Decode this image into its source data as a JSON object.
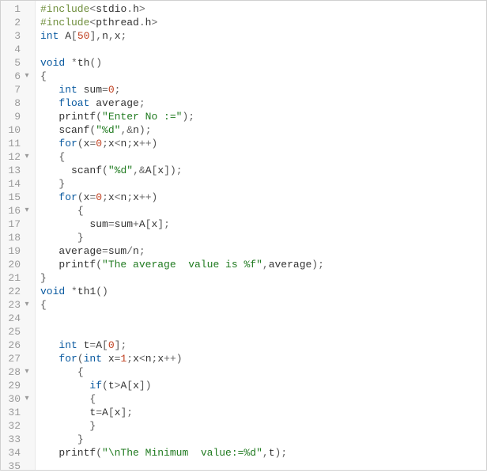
{
  "lines": [
    {
      "n": 1,
      "fold": "",
      "tokens": [
        [
          "pp",
          "#include"
        ],
        [
          "op",
          "<"
        ],
        [
          "id",
          "stdio"
        ],
        [
          "op",
          "."
        ],
        [
          "id",
          "h"
        ],
        [
          "op",
          ">"
        ]
      ]
    },
    {
      "n": 2,
      "fold": "",
      "tokens": [
        [
          "pp",
          "#include"
        ],
        [
          "op",
          "<"
        ],
        [
          "id",
          "pthread"
        ],
        [
          "op",
          "."
        ],
        [
          "id",
          "h"
        ],
        [
          "op",
          ">"
        ]
      ]
    },
    {
      "n": 3,
      "fold": "",
      "tokens": [
        [
          "ty",
          "int"
        ],
        [
          "id",
          " A"
        ],
        [
          "pn",
          "["
        ],
        [
          "num",
          "50"
        ],
        [
          "pn",
          "]"
        ],
        [
          "op",
          ","
        ],
        [
          "id",
          "n"
        ],
        [
          "op",
          ","
        ],
        [
          "id",
          "x"
        ],
        [
          "op",
          ";"
        ]
      ]
    },
    {
      "n": 4,
      "fold": "",
      "tokens": []
    },
    {
      "n": 5,
      "fold": "",
      "tokens": [
        [
          "ty",
          "void"
        ],
        [
          "id",
          " "
        ],
        [
          "op",
          "*"
        ],
        [
          "id",
          "th"
        ],
        [
          "pn",
          "()"
        ]
      ]
    },
    {
      "n": 6,
      "fold": "▾",
      "tokens": [
        [
          "pn",
          "{"
        ]
      ]
    },
    {
      "n": 7,
      "fold": "",
      "tokens": [
        [
          "id",
          "   "
        ],
        [
          "ty",
          "int"
        ],
        [
          "id",
          " sum"
        ],
        [
          "op",
          "="
        ],
        [
          "num",
          "0"
        ],
        [
          "op",
          ";"
        ]
      ]
    },
    {
      "n": 8,
      "fold": "",
      "tokens": [
        [
          "id",
          "   "
        ],
        [
          "ty",
          "float"
        ],
        [
          "id",
          " average"
        ],
        [
          "op",
          ";"
        ]
      ]
    },
    {
      "n": 9,
      "fold": "",
      "tokens": [
        [
          "id",
          "   "
        ],
        [
          "id",
          "printf"
        ],
        [
          "pn",
          "("
        ],
        [
          "str",
          "\"Enter No :=\""
        ],
        [
          "pn",
          ")"
        ],
        [
          "op",
          ";"
        ]
      ]
    },
    {
      "n": 10,
      "fold": "",
      "tokens": [
        [
          "id",
          "   "
        ],
        [
          "id",
          "scanf"
        ],
        [
          "pn",
          "("
        ],
        [
          "str",
          "\"%d\""
        ],
        [
          "op",
          ","
        ],
        [
          "op",
          "&"
        ],
        [
          "id",
          "n"
        ],
        [
          "pn",
          ")"
        ],
        [
          "op",
          ";"
        ]
      ]
    },
    {
      "n": 11,
      "fold": "",
      "tokens": [
        [
          "id",
          "   "
        ],
        [
          "kw",
          "for"
        ],
        [
          "pn",
          "("
        ],
        [
          "id",
          "x"
        ],
        [
          "op",
          "="
        ],
        [
          "num",
          "0"
        ],
        [
          "op",
          ";"
        ],
        [
          "id",
          "x"
        ],
        [
          "op",
          "<"
        ],
        [
          "id",
          "n"
        ],
        [
          "op",
          ";"
        ],
        [
          "id",
          "x"
        ],
        [
          "op",
          "++"
        ],
        [
          "pn",
          ")"
        ]
      ]
    },
    {
      "n": 12,
      "fold": "▾",
      "tokens": [
        [
          "id",
          "   "
        ],
        [
          "pn",
          "{"
        ]
      ]
    },
    {
      "n": 13,
      "fold": "",
      "tokens": [
        [
          "id",
          "     "
        ],
        [
          "id",
          "scanf"
        ],
        [
          "pn",
          "("
        ],
        [
          "str",
          "\"%d\""
        ],
        [
          "op",
          ","
        ],
        [
          "op",
          "&"
        ],
        [
          "id",
          "A"
        ],
        [
          "pn",
          "["
        ],
        [
          "id",
          "x"
        ],
        [
          "pn",
          "]"
        ],
        [
          "pn",
          ")"
        ],
        [
          "op",
          ";"
        ]
      ]
    },
    {
      "n": 14,
      "fold": "",
      "tokens": [
        [
          "id",
          "   "
        ],
        [
          "pn",
          "}"
        ]
      ]
    },
    {
      "n": 15,
      "fold": "",
      "tokens": [
        [
          "id",
          "   "
        ],
        [
          "kw",
          "for"
        ],
        [
          "pn",
          "("
        ],
        [
          "id",
          "x"
        ],
        [
          "op",
          "="
        ],
        [
          "num",
          "0"
        ],
        [
          "op",
          ";"
        ],
        [
          "id",
          "x"
        ],
        [
          "op",
          "<"
        ],
        [
          "id",
          "n"
        ],
        [
          "op",
          ";"
        ],
        [
          "id",
          "x"
        ],
        [
          "op",
          "++"
        ],
        [
          "pn",
          ")"
        ]
      ]
    },
    {
      "n": 16,
      "fold": "▾",
      "tokens": [
        [
          "id",
          "      "
        ],
        [
          "pn",
          "{"
        ]
      ]
    },
    {
      "n": 17,
      "fold": "",
      "tokens": [
        [
          "id",
          "        "
        ],
        [
          "id",
          "sum"
        ],
        [
          "op",
          "="
        ],
        [
          "id",
          "sum"
        ],
        [
          "op",
          "+"
        ],
        [
          "id",
          "A"
        ],
        [
          "pn",
          "["
        ],
        [
          "id",
          "x"
        ],
        [
          "pn",
          "]"
        ],
        [
          "op",
          ";"
        ]
      ]
    },
    {
      "n": 18,
      "fold": "",
      "tokens": [
        [
          "id",
          "      "
        ],
        [
          "pn",
          "}"
        ]
      ]
    },
    {
      "n": 19,
      "fold": "",
      "tokens": [
        [
          "id",
          "   "
        ],
        [
          "id",
          "average"
        ],
        [
          "op",
          "="
        ],
        [
          "id",
          "sum"
        ],
        [
          "op",
          "/"
        ],
        [
          "id",
          "n"
        ],
        [
          "op",
          ";"
        ]
      ]
    },
    {
      "n": 20,
      "fold": "",
      "tokens": [
        [
          "id",
          "   "
        ],
        [
          "id",
          "printf"
        ],
        [
          "pn",
          "("
        ],
        [
          "str",
          "\"The average  value is %f\""
        ],
        [
          "op",
          ","
        ],
        [
          "id",
          "average"
        ],
        [
          "pn",
          ")"
        ],
        [
          "op",
          ";"
        ]
      ]
    },
    {
      "n": 21,
      "fold": "",
      "tokens": [
        [
          "pn",
          "}"
        ]
      ]
    },
    {
      "n": 22,
      "fold": "",
      "tokens": [
        [
          "ty",
          "void"
        ],
        [
          "id",
          " "
        ],
        [
          "op",
          "*"
        ],
        [
          "id",
          "th1"
        ],
        [
          "pn",
          "()"
        ]
      ]
    },
    {
      "n": 23,
      "fold": "▾",
      "tokens": [
        [
          "pn",
          "{"
        ]
      ]
    },
    {
      "n": 24,
      "fold": "",
      "tokens": []
    },
    {
      "n": 25,
      "fold": "",
      "tokens": []
    },
    {
      "n": 26,
      "fold": "",
      "tokens": [
        [
          "id",
          "   "
        ],
        [
          "ty",
          "int"
        ],
        [
          "id",
          " t"
        ],
        [
          "op",
          "="
        ],
        [
          "id",
          "A"
        ],
        [
          "pn",
          "["
        ],
        [
          "num",
          "0"
        ],
        [
          "pn",
          "]"
        ],
        [
          "op",
          ";"
        ]
      ]
    },
    {
      "n": 27,
      "fold": "",
      "tokens": [
        [
          "id",
          "   "
        ],
        [
          "kw",
          "for"
        ],
        [
          "pn",
          "("
        ],
        [
          "ty",
          "int"
        ],
        [
          "id",
          " x"
        ],
        [
          "op",
          "="
        ],
        [
          "num",
          "1"
        ],
        [
          "op",
          ";"
        ],
        [
          "id",
          "x"
        ],
        [
          "op",
          "<"
        ],
        [
          "id",
          "n"
        ],
        [
          "op",
          ";"
        ],
        [
          "id",
          "x"
        ],
        [
          "op",
          "++"
        ],
        [
          "pn",
          ")"
        ]
      ]
    },
    {
      "n": 28,
      "fold": "▾",
      "tokens": [
        [
          "id",
          "      "
        ],
        [
          "pn",
          "{"
        ]
      ]
    },
    {
      "n": 29,
      "fold": "",
      "tokens": [
        [
          "id",
          "        "
        ],
        [
          "kw",
          "if"
        ],
        [
          "pn",
          "("
        ],
        [
          "id",
          "t"
        ],
        [
          "op",
          ">"
        ],
        [
          "id",
          "A"
        ],
        [
          "pn",
          "["
        ],
        [
          "id",
          "x"
        ],
        [
          "pn",
          "]"
        ],
        [
          "pn",
          ")"
        ]
      ]
    },
    {
      "n": 30,
      "fold": "▾",
      "tokens": [
        [
          "id",
          "        "
        ],
        [
          "pn",
          "{"
        ]
      ]
    },
    {
      "n": 31,
      "fold": "",
      "tokens": [
        [
          "id",
          "        "
        ],
        [
          "id",
          "t"
        ],
        [
          "op",
          "="
        ],
        [
          "id",
          "A"
        ],
        [
          "pn",
          "["
        ],
        [
          "id",
          "x"
        ],
        [
          "pn",
          "]"
        ],
        [
          "op",
          ";"
        ]
      ]
    },
    {
      "n": 32,
      "fold": "",
      "tokens": [
        [
          "id",
          "        "
        ],
        [
          "pn",
          "}"
        ]
      ]
    },
    {
      "n": 33,
      "fold": "",
      "tokens": [
        [
          "id",
          "      "
        ],
        [
          "pn",
          "}"
        ]
      ]
    },
    {
      "n": 34,
      "fold": "",
      "tokens": [
        [
          "id",
          "   "
        ],
        [
          "id",
          "printf"
        ],
        [
          "pn",
          "("
        ],
        [
          "str",
          "\"\\nThe Minimum  value:=%d\""
        ],
        [
          "op",
          ","
        ],
        [
          "id",
          "t"
        ],
        [
          "pn",
          ")"
        ],
        [
          "op",
          ";"
        ]
      ]
    },
    {
      "n": 35,
      "fold": "",
      "tokens": []
    }
  ]
}
